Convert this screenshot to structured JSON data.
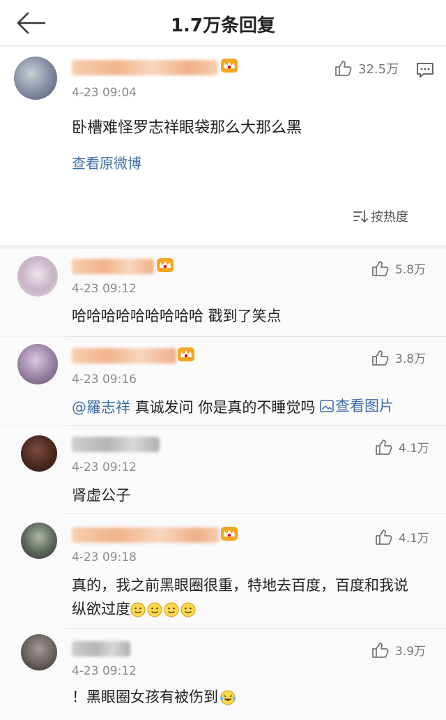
{
  "header": {
    "title": "1.7万条回复"
  },
  "main_comment": {
    "time": "4-23 09:04",
    "text": "卧槽难怪罗志祥眼袋那么大那么黑",
    "likes": "32.5万",
    "view_original": "查看原微博",
    "sort_label": "按热度"
  },
  "replies": [
    {
      "time": "4-23 09:12",
      "text": "哈哈哈哈哈哈哈哈哈 戳到了笑点",
      "likes": "5.8万"
    },
    {
      "time": "4-23 09:16",
      "mention": "@羅志祥",
      "text": " 真诚发问 你是真的不睡觉吗 ",
      "pic_label": "查看图片",
      "likes": "3.8万"
    },
    {
      "time": "4-23 09:12",
      "text": "肾虚公子",
      "likes": "4.1万"
    },
    {
      "time": "4-23 09:18",
      "text_line1": "真的，我之前黑眼圈很重，特地去百度，百度和我说",
      "text_line2": "纵欲过度",
      "likes": "4.1万"
    },
    {
      "time": "4-23 09:12",
      "text": "！黑眼圈女孩有被伤到",
      "likes": "3.9万"
    }
  ],
  "colors": {
    "link": "#3f6ea8",
    "crown": "#f5a623",
    "blur_name": "#f3c9a6"
  },
  "icons": [
    "back-arrow-icon",
    "crown-badge-icon",
    "thumbs-up-icon",
    "comment-icon",
    "sort-icon",
    "image-icon",
    "smile-emoji-icon",
    "laugh-cry-emoji-icon"
  ]
}
